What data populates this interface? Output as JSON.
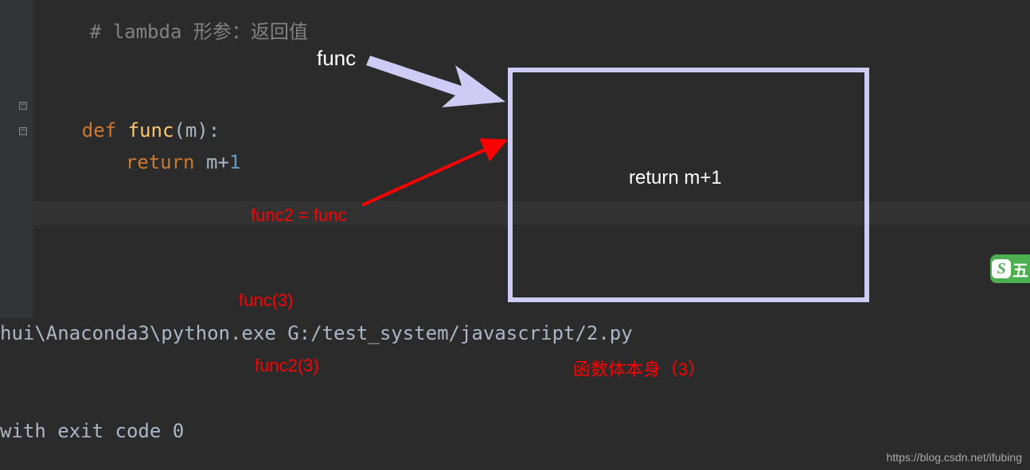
{
  "code": {
    "comment_line": "# lambda 形参：返回值",
    "def_kw": "def ",
    "func_name": "func",
    "open_paren": "(",
    "param": "m",
    "close_paren_colon": "):",
    "return_kw": "return ",
    "ret_var": "m",
    "ret_op": "+",
    "ret_num": "1"
  },
  "annotations": {
    "func_label": "func",
    "func2_assign": "func2 = func",
    "func_call": "func(3)",
    "func2_call": "func2(3)",
    "box_content": "return m+1",
    "body_call": "函数体本身（3）"
  },
  "terminal": {
    "run_line": "hui\\Anaconda3\\python.exe G:/test_system/javascript/2.py",
    "exit_line": " with exit code 0"
  },
  "watermark": "https://blog.csdn.net/ifubing",
  "badge": {
    "s": "S",
    "cn": "五"
  }
}
